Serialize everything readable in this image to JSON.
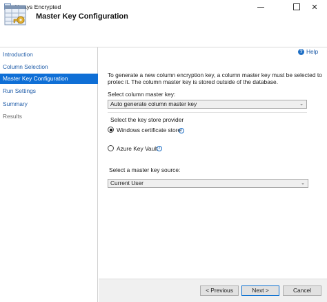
{
  "window": {
    "title": "Always Encrypted",
    "minimize_icon": "minimize-icon",
    "maximize_icon": "maximize-icon",
    "close_glyph": "✕"
  },
  "header": {
    "title": "Master Key Configuration",
    "icon": "wizard-key-icon"
  },
  "sidebar": {
    "items": [
      {
        "label": "Introduction",
        "state": "link"
      },
      {
        "label": "Column Selection",
        "state": "link"
      },
      {
        "label": "Master Key Configuration",
        "state": "active"
      },
      {
        "label": "Run Settings",
        "state": "link"
      },
      {
        "label": "Summary",
        "state": "link"
      },
      {
        "label": "Results",
        "state": "disabled"
      }
    ]
  },
  "help": {
    "label": "Help",
    "icon": "help-icon"
  },
  "main": {
    "description": "To generate a new column encryption key, a column master key must be selected to protec it. The column master key is stored outside of the database.",
    "cmk_label": "Select column master key:",
    "cmk_value": "Auto generate column master key",
    "provider_group_label": "Select the key store provider",
    "provider_options": [
      {
        "label": "Windows certificate store",
        "checked": true
      },
      {
        "label": "Azure Key Vault",
        "checked": false
      }
    ],
    "source_label": "Select a master key source:",
    "source_value": "Current User"
  },
  "footer": {
    "previous": "< Previous",
    "next": "Next >",
    "cancel": "Cancel"
  },
  "colors": {
    "accent": "#0f6fd6",
    "link": "#1f5ca8"
  }
}
